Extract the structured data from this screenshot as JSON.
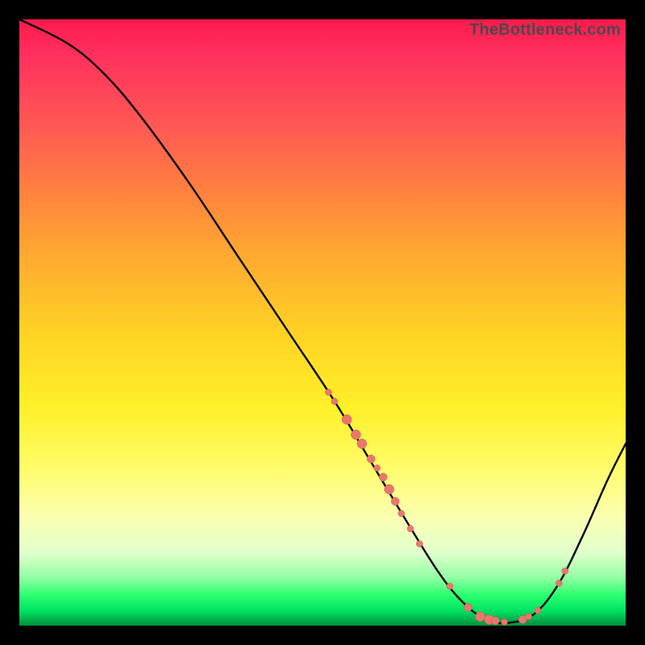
{
  "watermark": "TheBottleneck.com",
  "chart_data": {
    "type": "line",
    "title": "",
    "xlabel": "",
    "ylabel": "",
    "xlim": [
      0,
      100
    ],
    "ylim": [
      0,
      100
    ],
    "curve": [
      {
        "x": 0,
        "y": 100
      },
      {
        "x": 8,
        "y": 96
      },
      {
        "x": 14,
        "y": 91
      },
      {
        "x": 20,
        "y": 84
      },
      {
        "x": 28,
        "y": 73
      },
      {
        "x": 36,
        "y": 61
      },
      {
        "x": 44,
        "y": 49
      },
      {
        "x": 52,
        "y": 37
      },
      {
        "x": 58,
        "y": 27
      },
      {
        "x": 64,
        "y": 17
      },
      {
        "x": 69,
        "y": 9
      },
      {
        "x": 73,
        "y": 4
      },
      {
        "x": 77,
        "y": 1
      },
      {
        "x": 81,
        "y": 0.5
      },
      {
        "x": 85,
        "y": 2
      },
      {
        "x": 89,
        "y": 7
      },
      {
        "x": 93,
        "y": 15
      },
      {
        "x": 97,
        "y": 24
      },
      {
        "x": 100,
        "y": 30
      }
    ],
    "series": [
      {
        "name": "highlighted-points",
        "points": [
          {
            "x": 51,
            "y": 38.5,
            "r": 4
          },
          {
            "x": 52,
            "y": 37,
            "r": 4
          },
          {
            "x": 54,
            "y": 34,
            "r": 6
          },
          {
            "x": 55.5,
            "y": 31.5,
            "r": 6
          },
          {
            "x": 56.5,
            "y": 30,
            "r": 6
          },
          {
            "x": 58,
            "y": 27.5,
            "r": 5
          },
          {
            "x": 59,
            "y": 26,
            "r": 4
          },
          {
            "x": 60,
            "y": 24.5,
            "r": 5
          },
          {
            "x": 61,
            "y": 22.5,
            "r": 6
          },
          {
            "x": 62,
            "y": 20.5,
            "r": 5
          },
          {
            "x": 63,
            "y": 18.5,
            "r": 4
          },
          {
            "x": 64.5,
            "y": 16,
            "r": 4
          },
          {
            "x": 66,
            "y": 13.5,
            "r": 4
          },
          {
            "x": 71,
            "y": 6.5,
            "r": 4
          },
          {
            "x": 74,
            "y": 3,
            "r": 5
          },
          {
            "x": 76,
            "y": 1.5,
            "r": 6
          },
          {
            "x": 77.5,
            "y": 1,
            "r": 6
          },
          {
            "x": 78.5,
            "y": 0.8,
            "r": 5
          },
          {
            "x": 80,
            "y": 0.6,
            "r": 4
          },
          {
            "x": 83,
            "y": 1,
            "r": 5
          },
          {
            "x": 84,
            "y": 1.5,
            "r": 4
          },
          {
            "x": 85.5,
            "y": 2.5,
            "r": 4
          },
          {
            "x": 89,
            "y": 7,
            "r": 4
          },
          {
            "x": 90,
            "y": 9,
            "r": 4
          }
        ]
      }
    ],
    "background_gradient": {
      "top": "#ff1a4d",
      "mid": "#fff029",
      "bottom": "#00e463"
    }
  }
}
